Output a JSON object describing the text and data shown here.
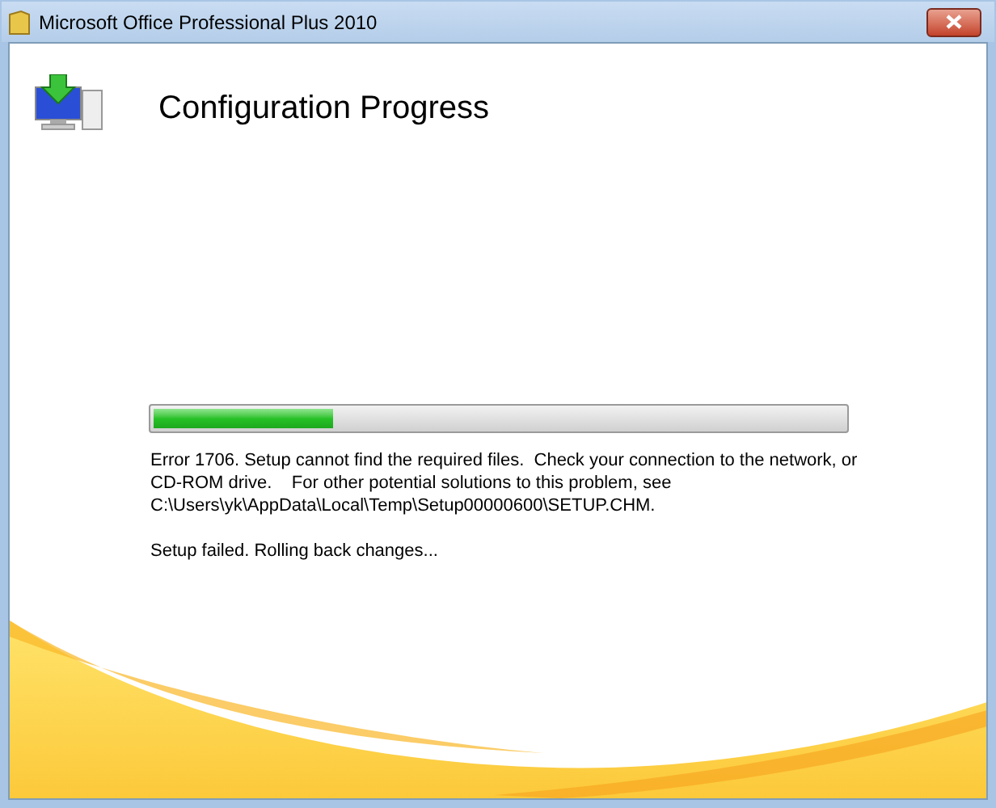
{
  "window": {
    "title": "Microsoft Office Professional Plus 2010"
  },
  "heading": "Configuration Progress",
  "progress": {
    "level": 0.26
  },
  "messages": [
    "Error 1706. Setup cannot find the required files.  Check your connection to the network, or CD-ROM drive.    For other potential solutions to this problem, see C:\\Users\\yk\\AppData\\Local\\Temp\\Setup00000600\\SETUP.CHM.",
    "Setup failed. Rolling back changes..."
  ]
}
